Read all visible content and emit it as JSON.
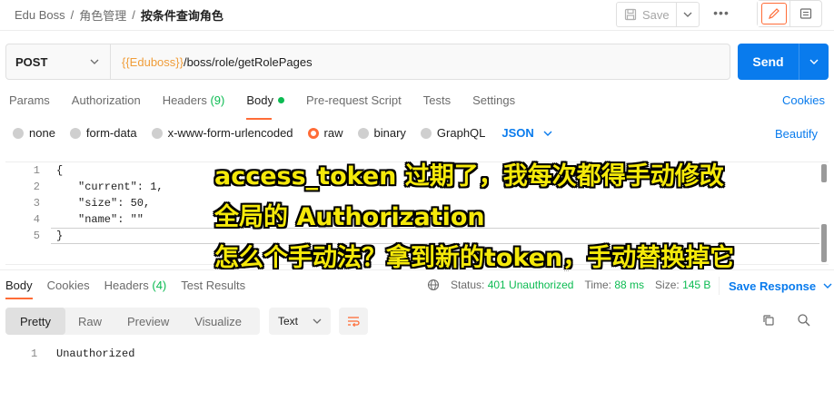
{
  "breadcrumb": {
    "items": [
      "Edu Boss",
      "角色管理"
    ],
    "current": "按条件查询角色",
    "separator": "/"
  },
  "toolbar": {
    "save_label": "Save",
    "more_label": "•••"
  },
  "request": {
    "method": "POST",
    "url_var": "{{Eduboss}}",
    "url_path": "/boss/role/getRolePages",
    "send_label": "Send"
  },
  "request_tabs": {
    "params": "Params",
    "authorization": "Authorization",
    "headers": "Headers",
    "headers_count": "(9)",
    "body": "Body",
    "prerequest": "Pre-request Script",
    "tests": "Tests",
    "settings": "Settings",
    "cookies": "Cookies"
  },
  "body_types": {
    "none": "none",
    "form_data": "form-data",
    "urlencoded": "x-www-form-urlencoded",
    "raw": "raw",
    "binary": "binary",
    "graphql": "GraphQL",
    "format": "JSON",
    "beautify": "Beautify"
  },
  "editor": {
    "lines": [
      {
        "n": "1",
        "text": "{"
      },
      {
        "n": "2",
        "text": "\"current\": 1,"
      },
      {
        "n": "3",
        "text": "\"size\": 50,"
      },
      {
        "n": "4",
        "text": "\"name\": \"\""
      },
      {
        "n": "5",
        "text": "}"
      }
    ]
  },
  "overlay": {
    "line1": "access_token 过期了，我每次都得手动修改",
    "line2": "全局的 Authorization",
    "line3": "怎么个手动法？拿到新的token，手动替换掉它"
  },
  "response_tabs": {
    "body": "Body",
    "cookies": "Cookies",
    "headers": "Headers",
    "headers_count": "(4)",
    "test_results": "Test Results"
  },
  "response_meta": {
    "status_label": "Status:",
    "status_value": "401 Unauthorized",
    "time_label": "Time:",
    "time_value": "88 ms",
    "size_label": "Size:",
    "size_value": "145 B",
    "save_response": "Save Response"
  },
  "response_view": {
    "pretty": "Pretty",
    "raw": "Raw",
    "preview": "Preview",
    "visualize": "Visualize",
    "format": "Text"
  },
  "response_body": {
    "line_number": "1",
    "text": "Unauthorized"
  },
  "colors": {
    "accent": "#ff6c37",
    "send": "#097bed",
    "status_ok": "#0cbb52",
    "variable": "#f09d3a",
    "overlay_text": "#f5e90a"
  },
  "icons": [
    "save-icon",
    "chevron-down-icon",
    "more-icon",
    "pencil-icon",
    "document-icon",
    "globe-icon",
    "wrap-lines-icon",
    "copy-icon",
    "search-icon"
  ]
}
